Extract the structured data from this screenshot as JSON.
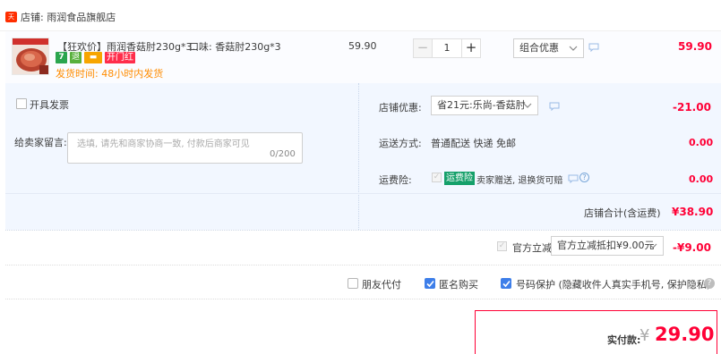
{
  "shop": {
    "icon_text": "天猫",
    "label": "店铺: 雨润食品旗舰店"
  },
  "item": {
    "title": "【狂欢价】雨润香菇肘230g*3...",
    "spec": "口味: 香菇肘230g*3",
    "badges": {
      "seven": "7",
      "guarantee": "退",
      "card": "▬",
      "hongbao": "开门红"
    },
    "ship_time": "发货时间: 48小时内发货",
    "unit_price": "59.90",
    "quantity": "1",
    "combo_select": "组合优惠",
    "total": "59.90"
  },
  "invoice": {
    "label": "开具发票"
  },
  "message": {
    "label": "给卖家留言:",
    "placeholder": "选填, 请先和商家协商一致, 付款后商家可见",
    "count": "0/200"
  },
  "discount": {
    "label": "店铺优惠:",
    "select": "省21元:乐尚-香菇肘",
    "amount": "-21.00"
  },
  "delivery": {
    "label": "运送方式:",
    "text": "普通配送 快递 免邮",
    "amount": "0.00"
  },
  "insurance": {
    "label": "运费险:",
    "tag": "运费险",
    "text": "卖家赠送, 退换货可赔",
    "help": "?",
    "amount": "0.00"
  },
  "shop_total": {
    "label": "店铺合计(含运费)",
    "amount": "¥38.90"
  },
  "official": {
    "label": "官方立减",
    "select": "官方立减抵扣¥9.00元",
    "amount": "-¥9.00"
  },
  "options": {
    "friend_pay": {
      "label": "朋友代付",
      "checked": false
    },
    "anonymous": {
      "label": "匿名购买",
      "checked": true
    },
    "privacy": {
      "label": "号码保护 (隐藏收件人真实手机号, 保护隐私)",
      "checked": true
    },
    "help": "?"
  },
  "pay": {
    "label": "实付款:",
    "currency": "¥",
    "amount": "29.90"
  },
  "colors": {
    "accent_red": "#ff0036",
    "checkbox_blue": "#3d7ee9",
    "panel_bg": "#f2f7ff",
    "insurance_green": "#15a06a",
    "ship_orange": "#ff8c00"
  }
}
